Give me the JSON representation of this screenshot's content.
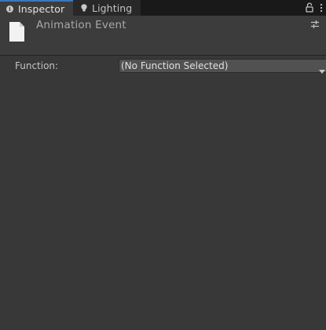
{
  "tabs": [
    {
      "label": "Inspector",
      "icon": "info-icon",
      "active": true
    },
    {
      "label": "Lighting",
      "icon": "lightbulb-icon",
      "active": false
    }
  ],
  "header": {
    "title": "Animation Event",
    "icon": "document-icon"
  },
  "properties": {
    "function_label": "Function:",
    "function_value": "(No Function Selected)"
  },
  "colors": {
    "background": "#383838",
    "tab_strip": "#191919",
    "active_tab_accent": "#3a79bb",
    "dropdown_bg": "#515151"
  }
}
